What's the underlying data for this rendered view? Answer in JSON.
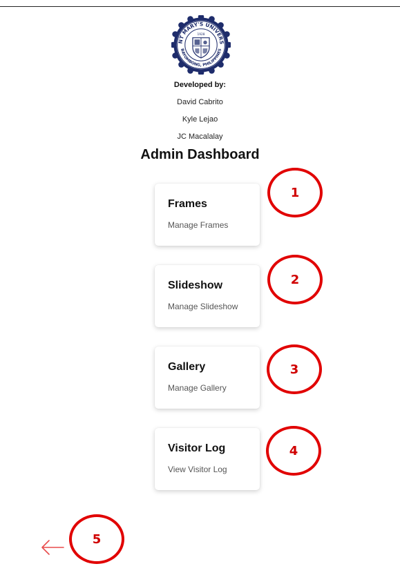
{
  "credits": {
    "heading": "Developed by:",
    "names": [
      "David Cabrito",
      "Kyle Lejao",
      "JC Macalalay"
    ]
  },
  "logo": {
    "icon": "university-seal-icon",
    "ring_text": "SAINT MARY'S UNIVERSITY",
    "bottom_text": "BAYOMBONG, PHILIPPINES",
    "year": "1928",
    "color": "#1e2c6b"
  },
  "page": {
    "title": "Admin Dashboard"
  },
  "cards": [
    {
      "title": "Frames",
      "subtitle": "Manage Frames"
    },
    {
      "title": "Slideshow",
      "subtitle": "Manage Slideshow"
    },
    {
      "title": "Gallery",
      "subtitle": "Manage Gallery"
    },
    {
      "title": "Visitor Log",
      "subtitle": "View Visitor Log"
    }
  ],
  "annotations": [
    "1",
    "2",
    "3",
    "4",
    "5"
  ],
  "back": {
    "icon": "arrow-left-icon",
    "color": "#e84c4c"
  },
  "colors": {
    "annotation": "#e10000",
    "card_title": "#111111",
    "card_subtitle": "#555555"
  }
}
